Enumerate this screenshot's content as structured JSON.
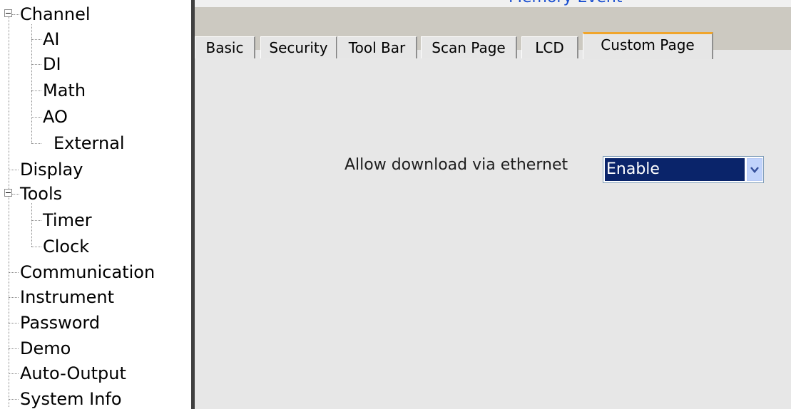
{
  "tree": {
    "items": [
      {
        "label": "Channel",
        "expandable": true
      },
      {
        "label": "AI"
      },
      {
        "label": "DI"
      },
      {
        "label": "Math"
      },
      {
        "label": "AO"
      },
      {
        "label": "External"
      },
      {
        "label": "Display"
      },
      {
        "label": "Tools",
        "expandable": true
      },
      {
        "label": "Timer"
      },
      {
        "label": "Clock"
      },
      {
        "label": "Communication"
      },
      {
        "label": "Instrument"
      },
      {
        "label": "Password"
      },
      {
        "label": "Demo"
      },
      {
        "label": "Auto-Output"
      },
      {
        "label": "System Info"
      }
    ]
  },
  "window": {
    "title": "Memory Event"
  },
  "tabs": [
    {
      "label": "Basic",
      "active": false
    },
    {
      "label": "Security",
      "active": false
    },
    {
      "label": "Tool Bar",
      "active": false
    },
    {
      "label": "Scan Page",
      "active": false
    },
    {
      "label": "LCD",
      "active": false
    },
    {
      "label": "Custom Page",
      "active": true
    }
  ],
  "form": {
    "download_label": "Allow download via ethernet",
    "download_value": "Enable"
  },
  "colors": {
    "active_tab_accent": "#f0a52c",
    "selection_bg": "#0a246a",
    "title_blue": "#1a4fd0"
  }
}
